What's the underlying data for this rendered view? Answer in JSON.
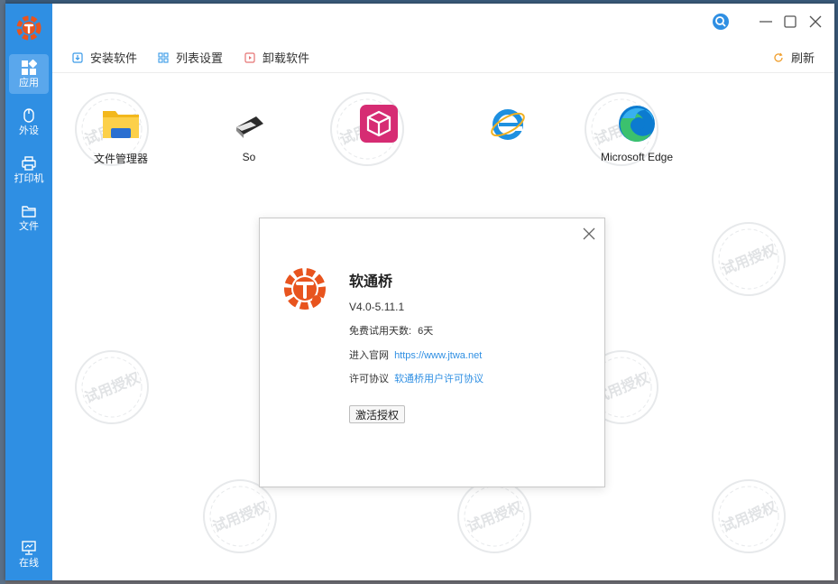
{
  "sidebar": {
    "items": [
      {
        "label": "应用",
        "icon": "apps-icon",
        "active": true
      },
      {
        "label": "外设",
        "icon": "mouse-icon",
        "active": false
      },
      {
        "label": "打印机",
        "icon": "printer-icon",
        "active": false
      },
      {
        "label": "文件",
        "icon": "folder-icon",
        "active": false
      }
    ],
    "bottom_item": {
      "label": "在线",
      "icon": "monitor-icon"
    }
  },
  "toolbar": {
    "install_label": "安装软件",
    "list_settings_label": "列表设置",
    "uninstall_label": "卸载软件",
    "refresh_label": "刷新"
  },
  "apps": [
    {
      "label": "文件管理器",
      "icon": "file-manager-icon"
    },
    {
      "label": "So",
      "icon": "scanner-icon"
    },
    {
      "label": "",
      "icon": "package-icon"
    },
    {
      "label": "",
      "icon": "internet-explorer-icon"
    },
    {
      "label": "Microsoft Edge",
      "icon": "edge-icon"
    }
  ],
  "watermark_text": "试用授权",
  "dialog": {
    "title": "软通桥",
    "version": "V4.0-5.11.1",
    "trial_label": "免费试用天数:",
    "trial_value": "6天",
    "website_label": "进入官网",
    "website_link": "https://www.jtwa.net",
    "license_label": "许可协议",
    "license_link": "软通桥用户许可协议",
    "activate_button": "激活授权"
  },
  "colors": {
    "sidebar": "#2f8fe3",
    "accent": "#2f8fe3",
    "logo": "#e8541e"
  }
}
